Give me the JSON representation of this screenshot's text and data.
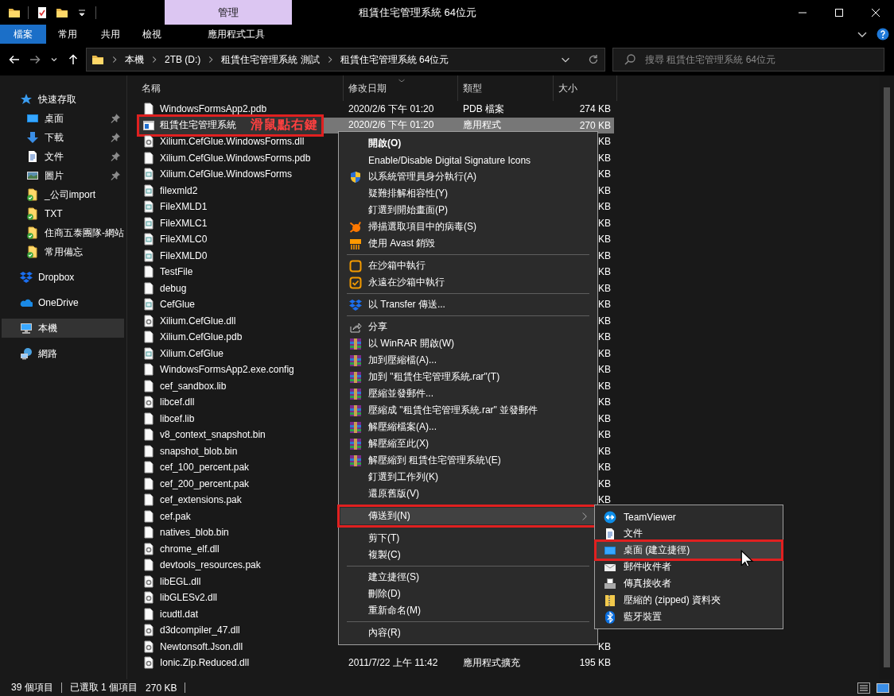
{
  "window": {
    "title": "租賃住宅管理系統 64位元",
    "context_tab": "管理"
  },
  "ribbon": {
    "tabs": [
      {
        "label": "檔案",
        "kind": "file",
        "selected": false
      },
      {
        "label": "常用",
        "kind": "plain",
        "selected": false
      },
      {
        "label": "共用",
        "kind": "plain",
        "selected": false
      },
      {
        "label": "檢視",
        "kind": "plain",
        "selected": false
      },
      {
        "label": "應用程式工具",
        "kind": "contextual",
        "selected": false
      }
    ]
  },
  "address": {
    "crumbs": [
      "本機",
      "2TB (D:)",
      "租賃住宅管理系統 測試",
      "租賃住宅管理系統 64位元"
    ]
  },
  "search": {
    "placeholder": "搜尋 租賃住宅管理系統 64位元"
  },
  "sidebar": {
    "items": [
      {
        "label": "快速存取",
        "kind": "quick",
        "selected": false,
        "children": [
          {
            "label": "桌面",
            "kind": "desktop",
            "pinned": true,
            "selected": false
          },
          {
            "label": "下載",
            "kind": "downloads",
            "pinned": true,
            "selected": false
          },
          {
            "label": "文件",
            "kind": "documents",
            "pinned": true,
            "selected": false
          },
          {
            "label": "圖片",
            "kind": "pictures",
            "pinned": true,
            "selected": false
          },
          {
            "label": "_公司import",
            "kind": "synced-folder",
            "pinned": false,
            "selected": false
          },
          {
            "label": "TXT",
            "kind": "synced-folder",
            "pinned": false,
            "selected": false
          },
          {
            "label": "住商五泰團隊-網站",
            "kind": "synced-folder",
            "pinned": false,
            "selected": false
          },
          {
            "label": "常用備忘",
            "kind": "synced-folder",
            "pinned": false,
            "selected": false
          }
        ]
      },
      {
        "label": "Dropbox",
        "kind": "dropbox",
        "selected": false
      },
      {
        "label": "OneDrive",
        "kind": "onedrive",
        "selected": false
      },
      {
        "label": "本機",
        "kind": "computer",
        "selected": true
      },
      {
        "label": "網路",
        "kind": "network",
        "selected": false
      }
    ]
  },
  "columns": [
    "名稱",
    "修改日期",
    "類型",
    "大小"
  ],
  "files": [
    {
      "name": "WindowsFormsApp2.pdb",
      "kind": "file",
      "selected": false,
      "date": "2020/2/6 下午 01:20",
      "type": "PDB 檔案",
      "size": "274 KB"
    },
    {
      "name": "租賃住宅管理系統",
      "kind": "app",
      "selected": true,
      "date": "2020/2/6 下午 01:20",
      "type": "應用程式",
      "size": "270 KB"
    },
    {
      "name": "Xilium.CefGlue.WindowsForms.dll",
      "kind": "dll",
      "selected": false,
      "size": "KB"
    },
    {
      "name": "Xilium.CefGlue.WindowsForms.pdb",
      "kind": "file",
      "selected": false,
      "size": "KB"
    },
    {
      "name": "Xilium.CefGlue.WindowsForms",
      "kind": "xml",
      "selected": false,
      "size": "KB"
    },
    {
      "name": "filexmld2",
      "kind": "xml",
      "selected": false,
      "size": "KB"
    },
    {
      "name": "FileXMLD1",
      "kind": "xml",
      "selected": false,
      "size": "KB"
    },
    {
      "name": "FileXMLC1",
      "kind": "xml",
      "selected": false,
      "size": "KB"
    },
    {
      "name": "FileXMLC0",
      "kind": "xml",
      "selected": false,
      "size": "KB"
    },
    {
      "name": "FileXMLD0",
      "kind": "xml",
      "selected": false,
      "size": "KB"
    },
    {
      "name": "TestFile",
      "kind": "file",
      "selected": false,
      "size": "KB"
    },
    {
      "name": "debug",
      "kind": "file",
      "selected": false,
      "size": "KB"
    },
    {
      "name": "CefGlue",
      "kind": "xml",
      "selected": false,
      "size": "KB"
    },
    {
      "name": "Xilium.CefGlue.dll",
      "kind": "dll",
      "selected": false,
      "size": "KB"
    },
    {
      "name": "Xilium.CefGlue.pdb",
      "kind": "file",
      "selected": false,
      "size": "KB"
    },
    {
      "name": "Xilium.CefGlue",
      "kind": "xml",
      "selected": false,
      "size": "KB"
    },
    {
      "name": "WindowsFormsApp2.exe.config",
      "kind": "file",
      "selected": false,
      "size": "KB"
    },
    {
      "name": "cef_sandbox.lib",
      "kind": "file",
      "selected": false,
      "size": "KB"
    },
    {
      "name": "libcef.dll",
      "kind": "dll",
      "selected": false,
      "size": "KB"
    },
    {
      "name": "libcef.lib",
      "kind": "file",
      "selected": false,
      "size": "KB"
    },
    {
      "name": "v8_context_snapshot.bin",
      "kind": "file",
      "selected": false,
      "size": "KB"
    },
    {
      "name": "snapshot_blob.bin",
      "kind": "file",
      "selected": false,
      "size": "KB"
    },
    {
      "name": "cef_100_percent.pak",
      "kind": "file",
      "selected": false,
      "size": "KB"
    },
    {
      "name": "cef_200_percent.pak",
      "kind": "file",
      "selected": false,
      "size": "KB"
    },
    {
      "name": "cef_extensions.pak",
      "kind": "file",
      "selected": false,
      "size": "KB"
    },
    {
      "name": "cef.pak",
      "kind": "file",
      "selected": false
    },
    {
      "name": "natives_blob.bin",
      "kind": "file",
      "selected": false
    },
    {
      "name": "chrome_elf.dll",
      "kind": "dll",
      "selected": false
    },
    {
      "name": "devtools_resources.pak",
      "kind": "file",
      "selected": false
    },
    {
      "name": "libEGL.dll",
      "kind": "dll",
      "selected": false
    },
    {
      "name": "libGLESv2.dll",
      "kind": "dll",
      "selected": false
    },
    {
      "name": "icudtl.dat",
      "kind": "file",
      "selected": false
    },
    {
      "name": "d3dcompiler_47.dll",
      "kind": "dll",
      "selected": false
    },
    {
      "name": "Newtonsoft.Json.dll",
      "kind": "dll",
      "selected": false,
      "size": "KB"
    },
    {
      "name": "Ionic.Zip.Reduced.dll",
      "kind": "dll",
      "selected": false,
      "date": "2011/7/22 上午 11:42",
      "type": "應用程式擴充",
      "size": "195 KB"
    }
  ],
  "annotation": {
    "text": "滑鼠點右鍵"
  },
  "context_menu": {
    "items": [
      {
        "label": "開啟(O)",
        "kind": "default",
        "selected": false
      },
      {
        "label": "Enable/Disable Digital Signature Icons",
        "kind": "plain",
        "selected": false
      },
      {
        "label": "以系統管理員身分執行(A)",
        "kind": "shield",
        "selected": false
      },
      {
        "label": "疑難排解相容性(Y)",
        "kind": "plain",
        "selected": false
      },
      {
        "label": "釘選到開始畫面(P)",
        "kind": "plain",
        "selected": false
      },
      {
        "label": "掃描選取項目中的病毒(S)",
        "kind": "avast",
        "selected": false
      },
      {
        "label": "使用 Avast 銷毀",
        "kind": "shredder",
        "selected": false
      },
      {
        "kind": "separator"
      },
      {
        "label": "在沙箱中執行",
        "kind": "sandbox",
        "selected": false
      },
      {
        "label": "永遠在沙箱中執行",
        "kind": "sandbox-check",
        "selected": false
      },
      {
        "kind": "separator"
      },
      {
        "label": "以 Transfer 傳送...",
        "kind": "dropbox",
        "selected": false
      },
      {
        "kind": "separator"
      },
      {
        "label": "分享",
        "kind": "share",
        "selected": false
      },
      {
        "label": "以 WinRAR 開啟(W)",
        "kind": "winrar",
        "selected": false
      },
      {
        "label": "加到壓縮檔(A)...",
        "kind": "winrar",
        "selected": false
      },
      {
        "label": "加到 \"租賃住宅管理系統.rar\"(T)",
        "kind": "winrar",
        "selected": false
      },
      {
        "label": "壓縮並發郵件...",
        "kind": "winrar",
        "selected": false
      },
      {
        "label": "壓縮成 \"租賃住宅管理系統.rar\" 並發郵件",
        "kind": "winrar",
        "selected": false
      },
      {
        "label": "解壓縮檔案(A)...",
        "kind": "winrar",
        "selected": false
      },
      {
        "label": "解壓縮至此(X)",
        "kind": "winrar",
        "selected": false
      },
      {
        "label": "解壓縮到 租賃住宅管理系統\\(E)",
        "kind": "winrar",
        "selected": false
      },
      {
        "label": "釘選到工作列(K)",
        "kind": "plain",
        "selected": false
      },
      {
        "label": "還原舊版(V)",
        "kind": "plain",
        "selected": false
      },
      {
        "kind": "separator"
      },
      {
        "label": "傳送到(N)",
        "kind": "submenu",
        "selected": true
      },
      {
        "kind": "separator"
      },
      {
        "label": "剪下(T)",
        "kind": "plain",
        "selected": false
      },
      {
        "label": "複製(C)",
        "kind": "plain",
        "selected": false
      },
      {
        "kind": "separator"
      },
      {
        "label": "建立捷徑(S)",
        "kind": "plain",
        "selected": false
      },
      {
        "label": "刪除(D)",
        "kind": "plain",
        "selected": false
      },
      {
        "label": "重新命名(M)",
        "kind": "plain",
        "selected": false
      },
      {
        "kind": "separator"
      },
      {
        "label": "內容(R)",
        "kind": "plain",
        "selected": false
      }
    ]
  },
  "send_to_menu": {
    "items": [
      {
        "label": "TeamViewer",
        "kind": "teamviewer",
        "selected": false
      },
      {
        "label": "文件",
        "kind": "documents",
        "selected": false
      },
      {
        "label": "桌面 (建立捷徑)",
        "kind": "desktop",
        "selected": true
      },
      {
        "label": "郵件收件者",
        "kind": "mail",
        "selected": false
      },
      {
        "label": "傳真接收者",
        "kind": "fax",
        "selected": false
      },
      {
        "label": "壓縮的 (zipped) 資料夾",
        "kind": "zip",
        "selected": false
      },
      {
        "label": "藍牙裝置",
        "kind": "bluetooth",
        "selected": false
      }
    ]
  },
  "status_bar": {
    "item_count": "39 個項目",
    "selection": "已選取 1 個項目",
    "selection_size": "270 KB"
  }
}
